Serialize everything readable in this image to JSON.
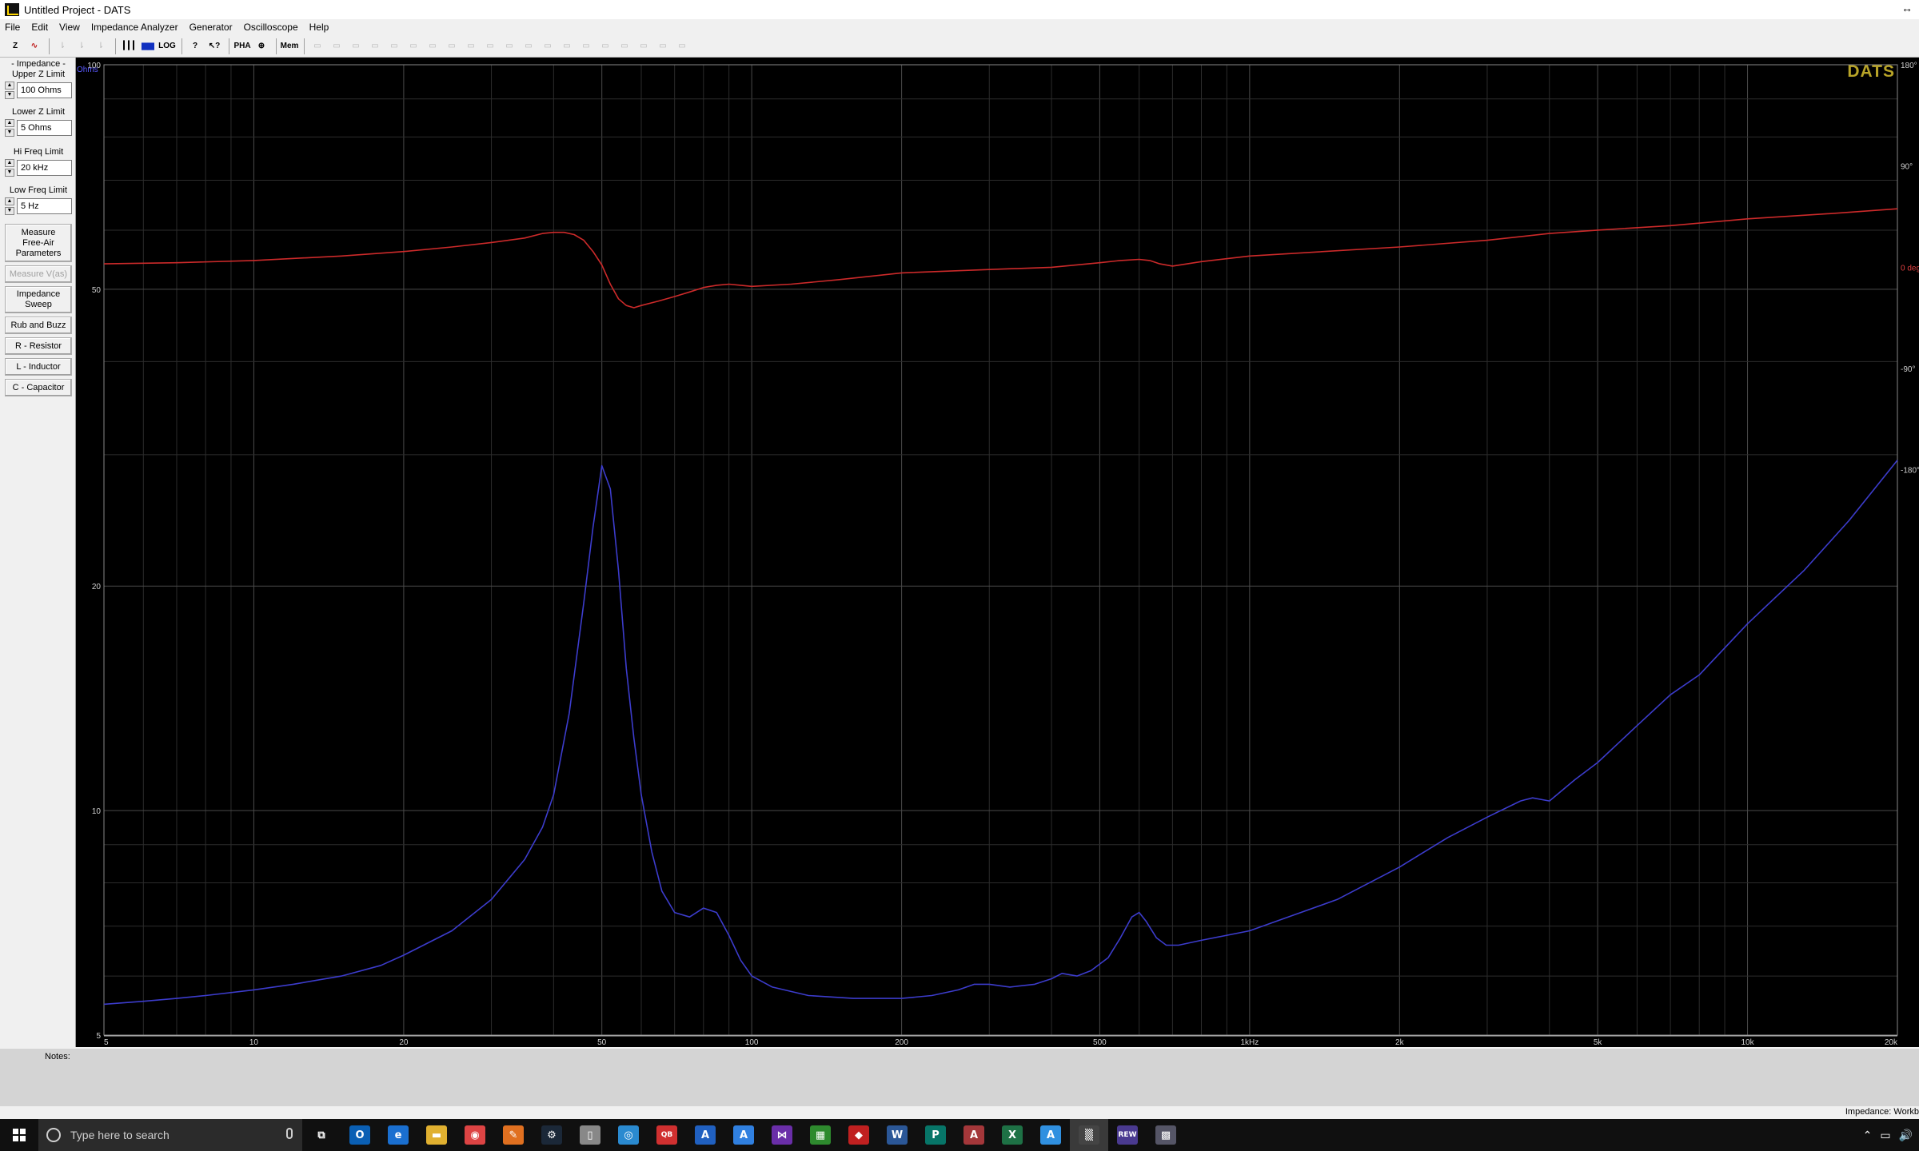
{
  "window": {
    "title": "Untitled Project - DATS"
  },
  "menu": [
    "File",
    "Edit",
    "View",
    "Impedance Analyzer",
    "Generator",
    "Oscilloscope",
    "Help"
  ],
  "toolbar": {
    "buttons": [
      {
        "icon": "impedance-z-icon",
        "label": "Z",
        "enabled": true
      },
      {
        "icon": "sine-wave-icon",
        "label": "∿",
        "enabled": true
      },
      {
        "icon": "cursor-icon",
        "label": "⇂",
        "enabled": false
      },
      {
        "icon": "cursor-icon",
        "label": "⇂",
        "enabled": false
      },
      {
        "icon": "cursor-icon",
        "label": "⇂",
        "enabled": false
      },
      {
        "icon": "grid-icon",
        "label": "┃┃┃",
        "enabled": true
      },
      {
        "icon": "bars-icon",
        "label": "▆▆",
        "enabled": true
      },
      {
        "icon": "log-icon",
        "label": "LOG",
        "enabled": true
      },
      {
        "icon": "help-icon",
        "label": "?",
        "enabled": true
      },
      {
        "icon": "context-help-icon",
        "label": "↖?",
        "enabled": true
      },
      {
        "icon": "phase-icon",
        "label": "PHA",
        "enabled": true
      },
      {
        "icon": "zoom-icon",
        "label": "⊕",
        "enabled": true
      },
      {
        "icon": "memory-icon",
        "label": "Mem",
        "enabled": true
      },
      {
        "icon": "memory-slot-icon",
        "label": "▭",
        "enabled": false
      },
      {
        "icon": "memory-slot-icon",
        "label": "▭",
        "enabled": false
      },
      {
        "icon": "memory-slot-icon",
        "label": "▭",
        "enabled": false
      },
      {
        "icon": "memory-slot-icon",
        "label": "▭",
        "enabled": false
      },
      {
        "icon": "memory-slot-icon",
        "label": "▭",
        "enabled": false
      },
      {
        "icon": "memory-slot-icon",
        "label": "▭",
        "enabled": false
      },
      {
        "icon": "memory-slot-icon",
        "label": "▭",
        "enabled": false
      },
      {
        "icon": "memory-slot-icon",
        "label": "▭",
        "enabled": false
      },
      {
        "icon": "memory-slot-icon",
        "label": "▭",
        "enabled": false
      },
      {
        "icon": "memory-slot-icon",
        "label": "▭",
        "enabled": false
      },
      {
        "icon": "memory-slot-icon",
        "label": "▭",
        "enabled": false
      },
      {
        "icon": "memory-slot-icon",
        "label": "▭",
        "enabled": false
      },
      {
        "icon": "memory-slot-icon",
        "label": "▭",
        "enabled": false
      },
      {
        "icon": "memory-slot-icon",
        "label": "▭",
        "enabled": false
      },
      {
        "icon": "memory-slot-icon",
        "label": "▭",
        "enabled": false
      },
      {
        "icon": "memory-slot-icon",
        "label": "▭",
        "enabled": false
      },
      {
        "icon": "memory-slot-icon",
        "label": "▭",
        "enabled": false
      },
      {
        "icon": "memory-slot-icon",
        "label": "▭",
        "enabled": false
      },
      {
        "icon": "memory-slot-icon",
        "label": "▭",
        "enabled": false
      },
      {
        "icon": "memory-slot-icon",
        "label": "▭",
        "enabled": false
      }
    ]
  },
  "sidebar": {
    "section_title": "- Impedance -",
    "upper_z": {
      "label": "Upper Z Limit",
      "value": "100 Ohms"
    },
    "lower_z": {
      "label": "Lower Z Limit",
      "value": "5 Ohms"
    },
    "hi_freq": {
      "label": "Hi Freq Limit",
      "value": "20 kHz"
    },
    "low_freq": {
      "label": "Low Freq Limit",
      "value": "5 Hz"
    },
    "buttons": {
      "free_air": "Measure Free-Air Parameters",
      "vas": "Measure V(as)",
      "sweep": "Impedance Sweep",
      "rub": "Rub and Buzz",
      "resistor": "R - Resistor",
      "inductor": "L - Inductor",
      "capacitor": "C - Capacitor"
    }
  },
  "plot": {
    "logo": "DATS",
    "units_label": "Ohms",
    "left_ticks": [
      "100",
      "50",
      "20",
      "10",
      "5"
    ],
    "right_ticks": [
      "180°",
      "90°",
      "0 deg",
      "-90°",
      "-180°"
    ],
    "x_ticks": [
      "5",
      "10",
      "20",
      "50",
      "100",
      "200",
      "500",
      "1kHz",
      "2k",
      "5k",
      "10k",
      "20k"
    ]
  },
  "chart_data": {
    "type": "line",
    "xscale": "log",
    "xlim": [
      5,
      20000
    ],
    "ylim": [
      5,
      100
    ],
    "yscale": "log",
    "phase_lim": [
      -180,
      180
    ],
    "grid": true,
    "series": [
      {
        "color": "#3c3ccc",
        "x": [
          5,
          6,
          7,
          8,
          10,
          12,
          15,
          18,
          20,
          25,
          30,
          35,
          38,
          40,
          43,
          46,
          48,
          50,
          52,
          54,
          56,
          58,
          60,
          63,
          66,
          70,
          75,
          80,
          85,
          90,
          95,
          100,
          110,
          130,
          160,
          200,
          230,
          260,
          280,
          300,
          330,
          370,
          400,
          420,
          450,
          480,
          520,
          550,
          580,
          600,
          620,
          650,
          680,
          720,
          800,
          1000,
          1500,
          2000,
          2500,
          3000,
          3500,
          3700,
          4000,
          4500,
          5000,
          6000,
          7000,
          8000,
          10000,
          13000,
          16000,
          20000
        ],
        "values": [
          5.5,
          5.55,
          5.6,
          5.65,
          5.75,
          5.85,
          6.0,
          6.2,
          6.4,
          6.9,
          7.6,
          8.6,
          9.5,
          10.5,
          13.5,
          19,
          24,
          29,
          27,
          21,
          15.5,
          12.5,
          10.5,
          8.8,
          7.8,
          7.3,
          7.2,
          7.4,
          7.3,
          6.8,
          6.3,
          6.0,
          5.8,
          5.65,
          5.6,
          5.6,
          5.65,
          5.75,
          5.85,
          5.85,
          5.8,
          5.85,
          5.95,
          6.05,
          6.0,
          6.1,
          6.35,
          6.75,
          7.2,
          7.3,
          7.1,
          6.75,
          6.6,
          6.6,
          6.7,
          6.9,
          7.6,
          8.4,
          9.2,
          9.8,
          10.3,
          10.4,
          10.3,
          11.0,
          11.6,
          13.0,
          14.3,
          15.2,
          17.8,
          21.0,
          24.5,
          29.5
        ]
      },
      {
        "color": "#cc2a2a",
        "axis": "phase",
        "x": [
          5,
          7,
          10,
          15,
          20,
          25,
          30,
          35,
          38,
          40,
          42,
          44,
          46,
          48,
          50,
          52,
          54,
          56,
          58,
          60,
          65,
          70,
          75,
          80,
          85,
          90,
          95,
          100,
          120,
          150,
          200,
          300,
          400,
          500,
          550,
          600,
          630,
          660,
          700,
          800,
          1000,
          2000,
          3000,
          4000,
          5000,
          7000,
          10000,
          15000,
          20000
        ],
        "values": [
          3,
          4,
          6,
          10,
          14,
          18,
          22,
          26,
          30,
          31,
          31,
          29,
          24,
          14,
          2,
          -15,
          -28,
          -34,
          -36,
          -34,
          -30,
          -26,
          -22,
          -18,
          -16,
          -15,
          -16,
          -17,
          -15,
          -11,
          -5,
          -2,
          0,
          4,
          6,
          7,
          6,
          3,
          1,
          5,
          10,
          18,
          24,
          30,
          33,
          37,
          43,
          48,
          52
        ]
      }
    ]
  },
  "notes": {
    "label": "Notes:"
  },
  "status": {
    "text": "Impedance: Workb"
  },
  "taskbar": {
    "search_placeholder": "Type here to search",
    "apps": [
      {
        "icon": "task-view-icon",
        "glyph": "⧉",
        "color": "#101010",
        "active": false
      },
      {
        "icon": "outlook-icon",
        "glyph": "O",
        "color": "#0a5fb4",
        "active": false
      },
      {
        "icon": "edge-icon",
        "glyph": "e",
        "color": "#1a6fd0",
        "active": false
      },
      {
        "icon": "file-explorer-icon",
        "glyph": "▬",
        "color": "#e0b030",
        "active": false
      },
      {
        "icon": "chrome-icon",
        "glyph": "◉",
        "color": "#d44",
        "active": false
      },
      {
        "icon": "app-orange-icon",
        "glyph": "✎",
        "color": "#e07020",
        "active": false
      },
      {
        "icon": "steam-icon",
        "glyph": "⚙",
        "color": "#1b2838",
        "active": false
      },
      {
        "icon": "file-icon",
        "glyph": "▯",
        "color": "#888",
        "active": false
      },
      {
        "icon": "app-globe-icon",
        "glyph": "◎",
        "color": "#2a8ad0",
        "active": false
      },
      {
        "icon": "quickbooks-icon",
        "glyph": "QB",
        "color": "#d03030",
        "active": false
      },
      {
        "icon": "app-a-icon",
        "glyph": "A",
        "color": "#2060c0",
        "active": false
      },
      {
        "icon": "app-a2-icon",
        "glyph": "A",
        "color": "#3080e0",
        "active": false
      },
      {
        "icon": "visual-studio-icon",
        "glyph": "⋈",
        "color": "#6a2ea8",
        "active": false
      },
      {
        "icon": "stock-icon",
        "glyph": "▦",
        "color": "#2e8a2e",
        "active": false
      },
      {
        "icon": "app-red-icon",
        "glyph": "◆",
        "color": "#c02020",
        "active": false
      },
      {
        "icon": "word-icon",
        "glyph": "W",
        "color": "#2b5797",
        "active": false
      },
      {
        "icon": "publisher-icon",
        "glyph": "P",
        "color": "#077568",
        "active": false
      },
      {
        "icon": "access-icon",
        "glyph": "A",
        "color": "#a4373a",
        "active": false
      },
      {
        "icon": "excel-icon",
        "glyph": "X",
        "color": "#1e7145",
        "active": false
      },
      {
        "icon": "app-a3-icon",
        "glyph": "A",
        "color": "#3090e0",
        "active": false
      },
      {
        "icon": "dats-icon",
        "glyph": "▒",
        "color": "#444",
        "active": true
      },
      {
        "icon": "rew-icon",
        "glyph": "REW",
        "color": "#4a3a90",
        "active": false
      },
      {
        "icon": "app-grid-icon",
        "glyph": "▩",
        "color": "#556",
        "active": false
      }
    ],
    "tray": [
      "⌃",
      "▭",
      "🔊"
    ]
  }
}
